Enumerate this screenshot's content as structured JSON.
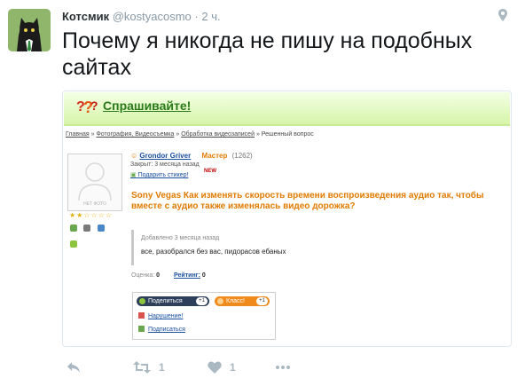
{
  "tweet": {
    "author_name": "Котсмик",
    "author_handle": "@kostyacosmo",
    "separator": "·",
    "time": "2 ч.",
    "text": "Почему я никогда не пишу на подобных сайтах",
    "avatar_icon": "cat-avatar-icon",
    "pin_icon": "location-pin-icon"
  },
  "card": {
    "site_title": "Спрашивайте!",
    "breadcrumbs": [
      "Главная",
      "Фотография, Видеосъемка",
      "Обработка видеозаписей",
      "Решенный вопрос"
    ],
    "crumb_sep": "»",
    "photo_caption": "НЕТ ФОТО",
    "stars": "★★☆☆☆☆",
    "user": {
      "name": "Grondor Griver",
      "rank": "Мастер",
      "score": "(1262)"
    },
    "closed": "Закрыт: 3 месяца назад",
    "sticker_link": "Подарить стикер!",
    "new_badge": "NEW",
    "question": "Sony Vegas Как изменять скорость времени воспроизведения аудио так, чтобы вместе с аудио также изменялась видео дорожка?",
    "answer": {
      "added": "Добавлено 3 месяца назад",
      "text": "все, разобрался без вас, пидорасов ебаных"
    },
    "rating": {
      "label": "Оценка:",
      "value": "0",
      "link": "Рейтинг:",
      "link_value": "0"
    },
    "share": {
      "share_label": "Поделиться",
      "share_count": "+1",
      "klass_label": "Класс!",
      "klass_count": "+1",
      "violation": "Нарушение!",
      "subscribe": "Подписаться"
    },
    "colors": {
      "accent_green": "#2a7a1a",
      "question_orange": "#e07b00",
      "link_blue": "#1a4fa0"
    }
  },
  "actions": {
    "reply_icon": "reply-icon",
    "retweet_icon": "retweet-icon",
    "retweet_count": "1",
    "like_icon": "heart-icon",
    "like_count": "1",
    "more_icon": "more-dots-icon"
  }
}
